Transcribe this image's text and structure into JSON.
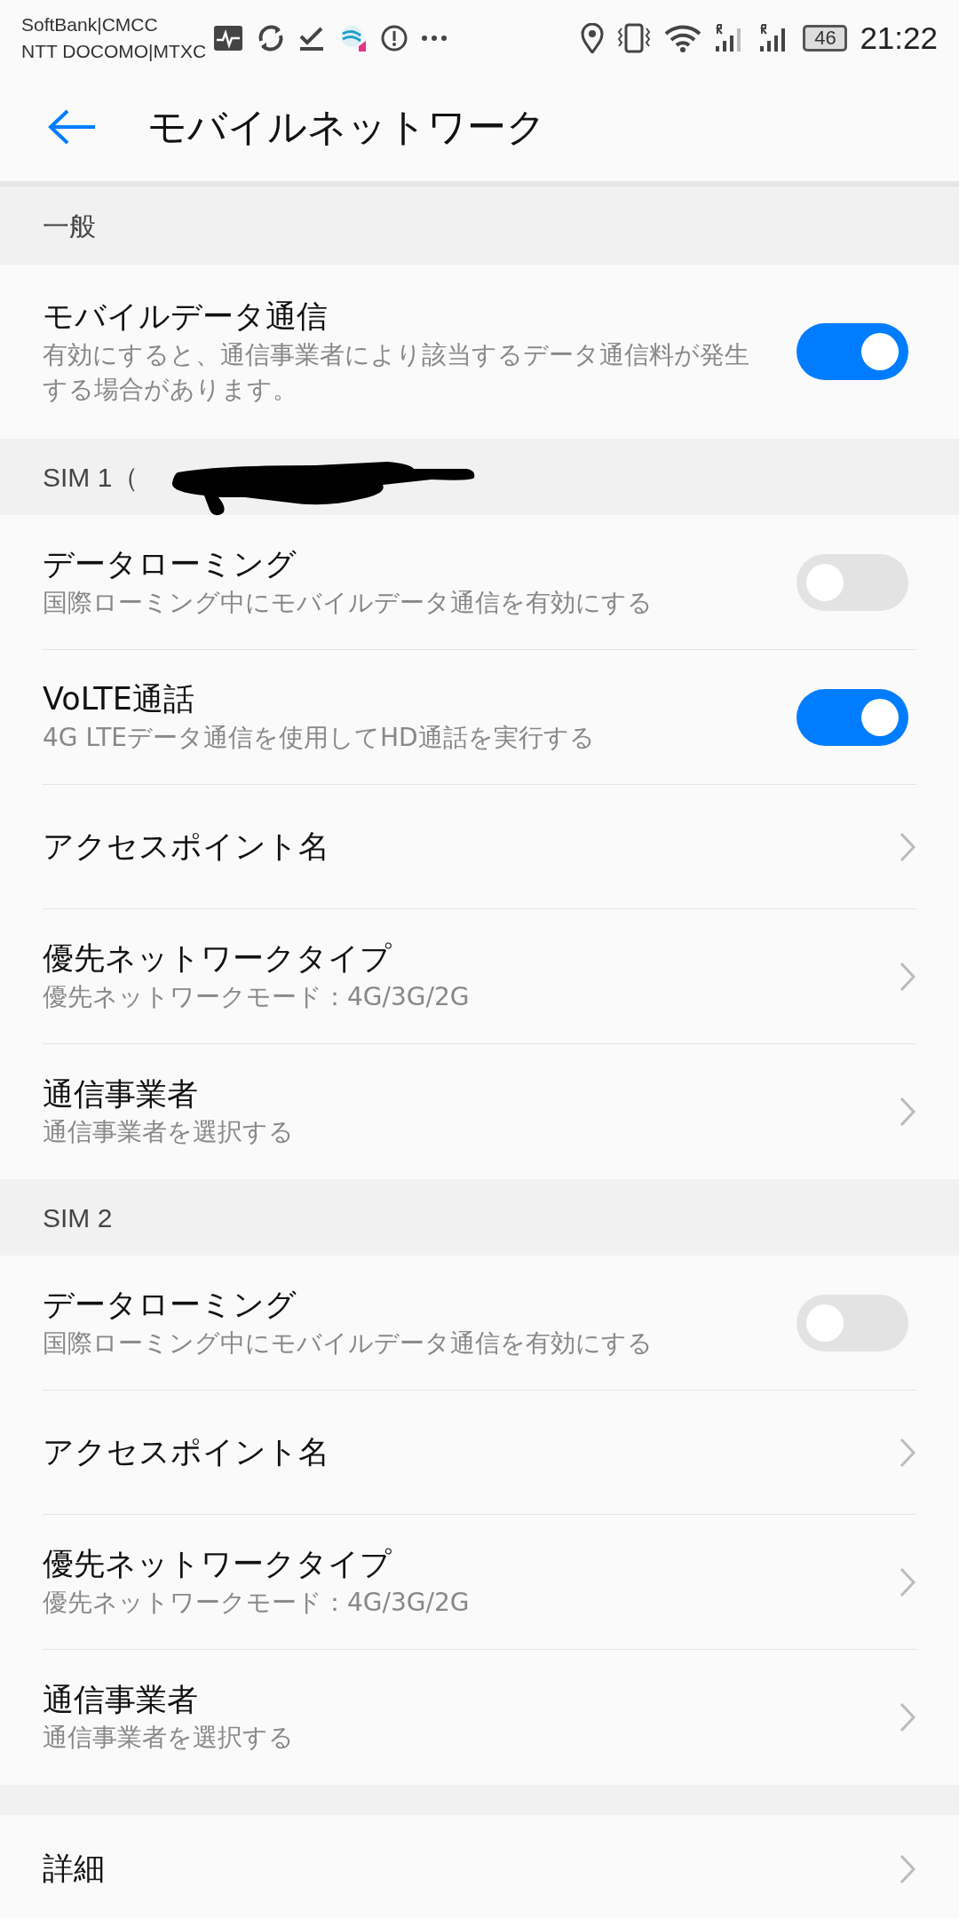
{
  "status_bar": {
    "carriers": [
      "SoftBank|CMCC",
      "NTT DOCOMO|MTXC"
    ],
    "battery": "46",
    "time": "21:22"
  },
  "header": {
    "title": "モバイルネットワーク"
  },
  "sections": [
    {
      "title": "一般",
      "items": [
        {
          "kind": "toggle",
          "title": "モバイルデータ通信",
          "subtitle": "有効にすると、通信事業者により該当するデータ通信料が発生する場合があります。",
          "on": true
        }
      ]
    },
    {
      "title": "SIM 1（",
      "redacted": true,
      "items": [
        {
          "kind": "toggle",
          "title": "データローミング",
          "subtitle": "国際ローミング中にモバイルデータ通信を有効にする",
          "on": false
        },
        {
          "kind": "toggle",
          "title": "VoLTE通話",
          "subtitle": "4G LTEデータ通信を使用してHD通話を実行する",
          "on": true
        },
        {
          "kind": "link",
          "title": "アクセスポイント名"
        },
        {
          "kind": "link",
          "title": "優先ネットワークタイプ",
          "subtitle": "優先ネットワークモード：4G/3G/2G"
        },
        {
          "kind": "link",
          "title": "通信事業者",
          "subtitle": "通信事業者を選択する"
        }
      ]
    },
    {
      "title": "SIM 2",
      "items": [
        {
          "kind": "toggle",
          "title": "データローミング",
          "subtitle": "国際ローミング中にモバイルデータ通信を有効にする",
          "on": false
        },
        {
          "kind": "link",
          "title": "アクセスポイント名"
        },
        {
          "kind": "link",
          "title": "優先ネットワークタイプ",
          "subtitle": "優先ネットワークモード：4G/3G/2G"
        },
        {
          "kind": "link",
          "title": "通信事業者",
          "subtitle": "通信事業者を選択する"
        }
      ]
    },
    {
      "items": [
        {
          "kind": "link",
          "title": "詳細"
        }
      ]
    }
  ]
}
